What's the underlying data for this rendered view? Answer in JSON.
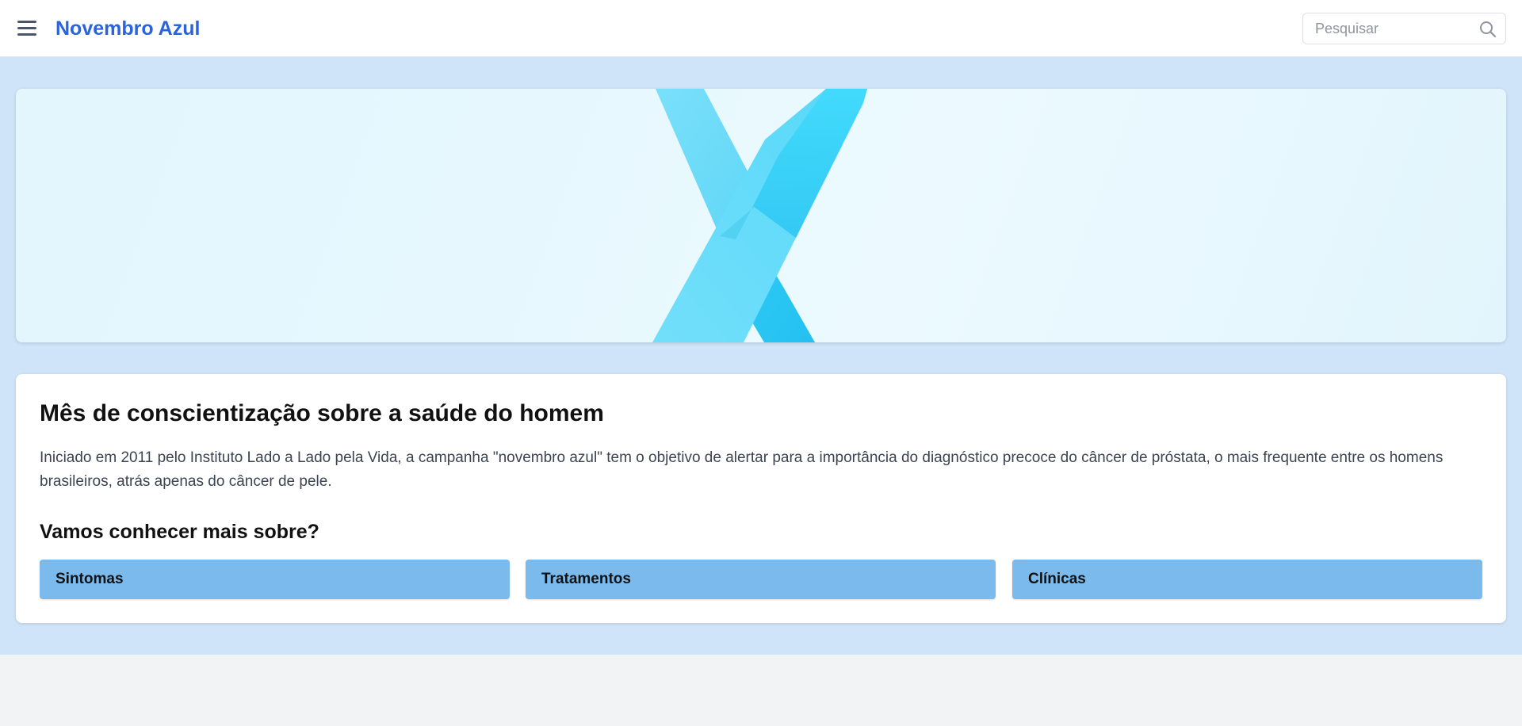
{
  "header": {
    "title": "Novembro Azul",
    "menu_icon": "hamburger-menu-icon",
    "search": {
      "placeholder": "Pesquisar",
      "value": "",
      "icon": "search-icon"
    }
  },
  "hero": {
    "image": "blue-awareness-ribbon",
    "colors": {
      "ribbon_light": "#71dcf9",
      "ribbon_main": "#3fd4f9",
      "ribbon_dark": "#2ec8f4"
    }
  },
  "content": {
    "title": "Mês de conscientização sobre a saúde do homem",
    "description": "Iniciado em 2011 pelo Instituto Lado a Lado pela Vida, a campanha \"novembro azul\" tem o objetivo de alertar para a importância do diagnóstico precoce do câncer de próstata, o mais frequente entre os homens brasileiros, atrás apenas do câncer de pele.",
    "subtitle": "Vamos conhecer mais sobre?",
    "buttons": [
      {
        "label": "Sintomas"
      },
      {
        "label": "Tratamentos"
      },
      {
        "label": "Clínicas"
      }
    ]
  },
  "colors": {
    "brand": "#2a63e0",
    "page_background": "#cfe4f8",
    "button_background": "#7bbaec",
    "footer_background": "#f2f3f5"
  }
}
